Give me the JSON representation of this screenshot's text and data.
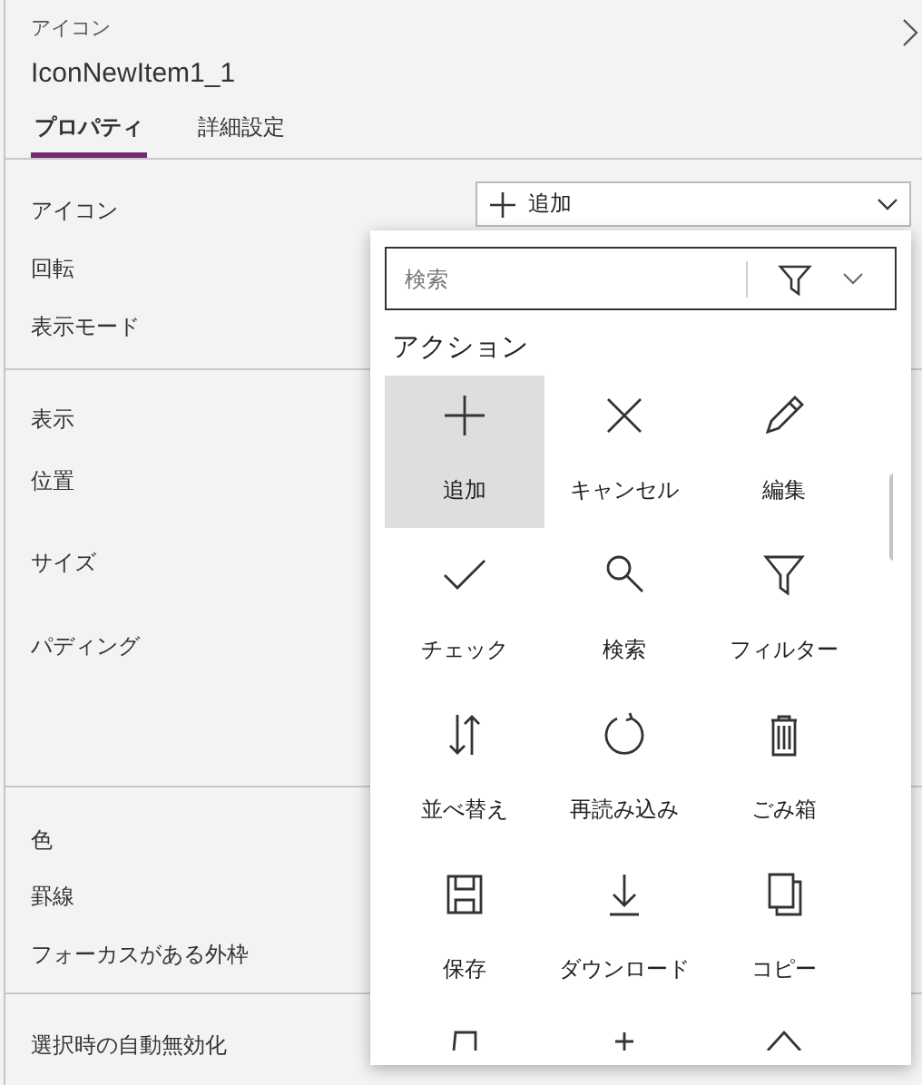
{
  "header": {
    "kind_label": "アイコン",
    "control_name": "IconNewItem1_1"
  },
  "tabs": [
    {
      "label": "プロパティ",
      "selected": true
    },
    {
      "label": "詳細設定",
      "selected": false
    }
  ],
  "sections": [
    {
      "rows": [
        {
          "label": "アイコン"
        },
        {
          "label": "回転"
        },
        {
          "label": "表示モード"
        }
      ]
    },
    {
      "rows": [
        {
          "label": "表示"
        },
        {
          "label": "位置"
        },
        {
          "label": "サイズ"
        },
        {
          "label": "パディング"
        }
      ]
    },
    {
      "rows": [
        {
          "label": "色"
        },
        {
          "label": "罫線"
        },
        {
          "label": "フォーカスがある外枠"
        }
      ]
    },
    {
      "rows": [
        {
          "label": "選択時の自動無効化"
        }
      ]
    }
  ],
  "icon_dropdown": {
    "value": "追加",
    "expanded": true
  },
  "icon_picker": {
    "search_placeholder": "検索",
    "category": "アクション",
    "items": [
      {
        "label": "追加",
        "selected": true
      },
      {
        "label": "キャンセル",
        "selected": false
      },
      {
        "label": "編集",
        "selected": false
      },
      {
        "label": "チェック",
        "selected": false
      },
      {
        "label": "検索",
        "selected": false
      },
      {
        "label": "フィルター",
        "selected": false
      },
      {
        "label": "並べ替え",
        "selected": false
      },
      {
        "label": "再読み込み",
        "selected": false
      },
      {
        "label": "ごみ箱",
        "selected": false
      },
      {
        "label": "保存",
        "selected": false
      },
      {
        "label": "ダウンロード",
        "selected": false
      },
      {
        "label": "コピー",
        "selected": false
      }
    ]
  }
}
